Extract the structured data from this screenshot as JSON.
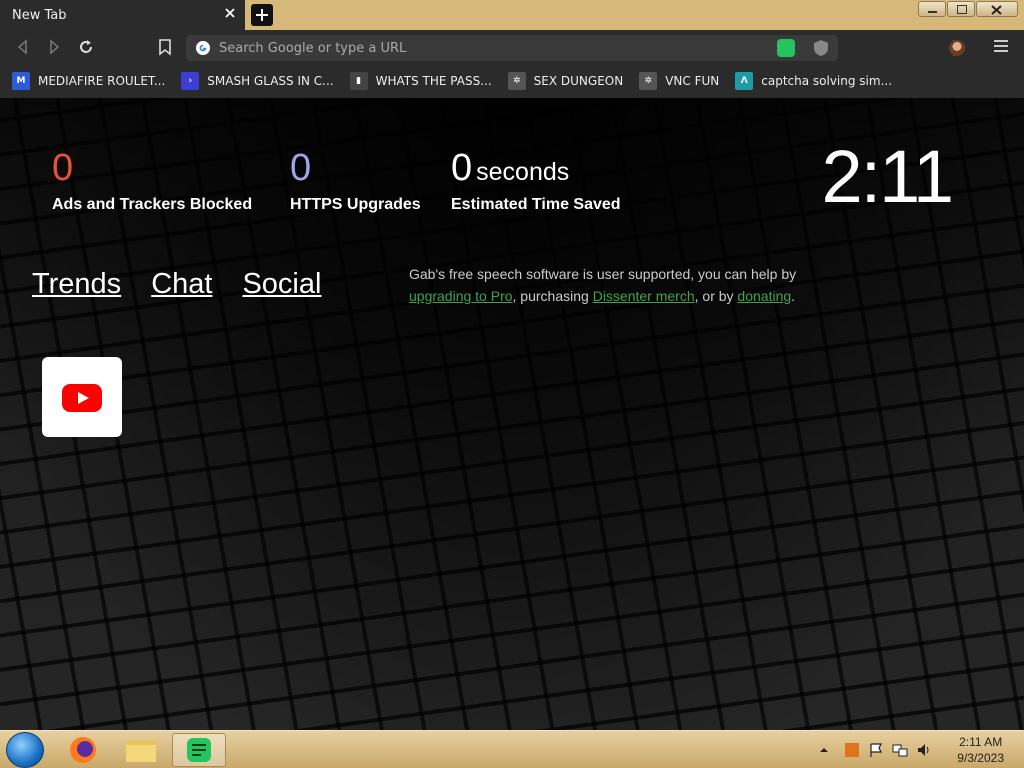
{
  "browser": {
    "tab": {
      "title": "New Tab"
    },
    "omnibox": {
      "placeholder": "Search Google or type a URL",
      "value": ""
    },
    "bookmarks": [
      {
        "label": "MEDIAFIRE ROULET...",
        "icon": "mediafire-icon",
        "color": "#2e5bd8"
      },
      {
        "label": "SMASH GLASS IN C...",
        "icon": "smash-glass-icon",
        "color": "#3b3fd4"
      },
      {
        "label": "WHATS THE PASS...",
        "icon": "terminal-icon",
        "color": "#444444"
      },
      {
        "label": "SEX DUNGEON",
        "icon": "gear-site-icon",
        "color": "#555555"
      },
      {
        "label": "VNC FUN",
        "icon": "gear-site-icon",
        "color": "#555555"
      },
      {
        "label": "captcha solving sim...",
        "icon": "captcha-icon",
        "color": "#1e9aa8"
      }
    ]
  },
  "newtab": {
    "stats": {
      "ads": {
        "value": "0",
        "label": "Ads and Trackers Blocked",
        "color": "#e5533d"
      },
      "https": {
        "value": "0",
        "label": "HTTPS Upgrades",
        "color": "#a0a5eb"
      },
      "time": {
        "value": "0",
        "unit": "seconds",
        "label": "Estimated Time Saved",
        "color": "#ffffff"
      }
    },
    "clock": "2:11",
    "links": [
      "Trends",
      "Chat",
      "Social"
    ],
    "gab": {
      "text1": "Gab's free speech software is user supported, you can help by ",
      "link1": "upgrading to Pro",
      "text2": ", purchasing ",
      "link2": "Dissenter merch",
      "text3": ", or by ",
      "link3": "donating",
      "text4": "."
    },
    "tile": {
      "icon": "youtube-icon"
    }
  },
  "taskbar": {
    "time": "2:11 AM",
    "date": "9/3/2023"
  }
}
